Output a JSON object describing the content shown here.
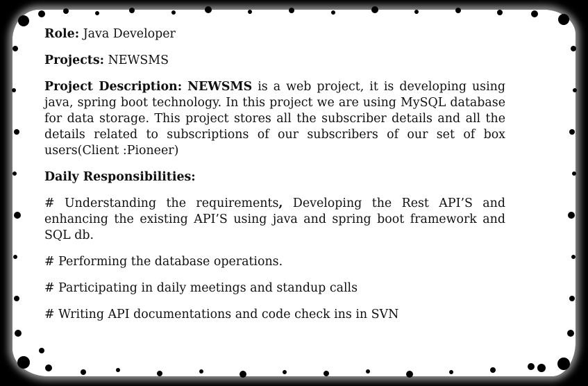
{
  "role": {
    "label": "Role:",
    "value": "Java Developer"
  },
  "projects": {
    "label": "Projects:",
    "value": "NEWSMS"
  },
  "project_description": {
    "label": "Project Description:",
    "name": "NEWSMS",
    "text": "is a web project, it is developing using java, spring boot technology. In this project we are using MySQL database for data storage. This project stores all the subscriber details and all the details related to subscriptions of our subscribers of our set of box users(Client :Pioneer)"
  },
  "daily_responsibilities": {
    "heading": "Daily Responsibilities:",
    "items": [
      {
        "part1": "# Understanding the requirements",
        "sep": ",",
        "part2": " Developing the Rest API’S and enhancing the existing API’S using java and spring boot framework and SQL db."
      },
      {
        "text": "# Performing the database operations."
      },
      {
        "text": "# Participating in daily meetings and standup calls"
      },
      {
        "text": "# Writing API documentations and code check ins in SVN"
      }
    ]
  }
}
